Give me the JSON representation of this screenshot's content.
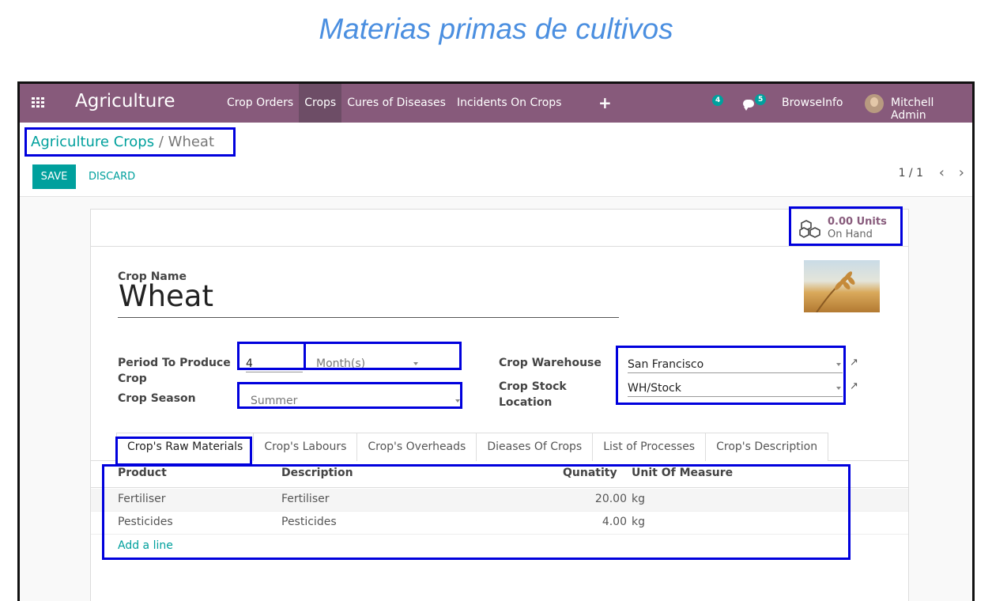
{
  "caption": "Materias primas de cultivos",
  "navbar": {
    "app_name": "Agriculture",
    "menu": [
      "Crop Orders",
      "Crops",
      "Cures of Diseases",
      "Incidents On Crops"
    ],
    "activity_count": "4",
    "message_count": "5",
    "company": "BrowseInfo",
    "user": "Mitchell Admin"
  },
  "breadcrumb": {
    "parent": "Agriculture Crops",
    "separator": "/",
    "current": "Wheat"
  },
  "actions": {
    "save": "SAVE",
    "discard": "DISCARD"
  },
  "pager": {
    "text": "1 / 1",
    "prev": "‹",
    "next": "›"
  },
  "stat_button": {
    "value": "0.00 Units",
    "label": "On Hand"
  },
  "form": {
    "crop_name_label": "Crop Name",
    "crop_name": "Wheat",
    "period_label": "Period To Produce Crop",
    "period_value": "4",
    "period_unit": "Month(s)",
    "season_label": "Crop Season",
    "season_value": "Summer",
    "warehouse_label": "Crop Warehouse",
    "warehouse_value": "San Francisco",
    "stock_location_label": "Crop Stock Location",
    "stock_location_value": "WH/Stock"
  },
  "tabs": [
    "Crop's Raw Materials",
    "Crop's Labours",
    "Crop's Overheads",
    "Dieases Of Crops",
    "List of Processes",
    "Crop's Description"
  ],
  "table": {
    "headers": {
      "product": "Product",
      "description": "Description",
      "quantity": "Qunatity",
      "uom": "Unit Of Measure"
    },
    "rows": [
      {
        "product": "Fertiliser",
        "description": "Fertiliser",
        "quantity": "20.00",
        "uom": "kg"
      },
      {
        "product": "Pesticides",
        "description": "Pesticides",
        "quantity": "4.00",
        "uom": "kg"
      }
    ],
    "add_line": "Add a line"
  },
  "colors": {
    "brand": "#875a7b",
    "accent": "#00a09d",
    "highlight": "#0000dd",
    "caption": "#4b8fe0"
  },
  "icons": [
    "apps-grid-icon",
    "plus-icon",
    "chat-icon",
    "cubes-icon",
    "external-link-icon",
    "caret-down-icon"
  ]
}
